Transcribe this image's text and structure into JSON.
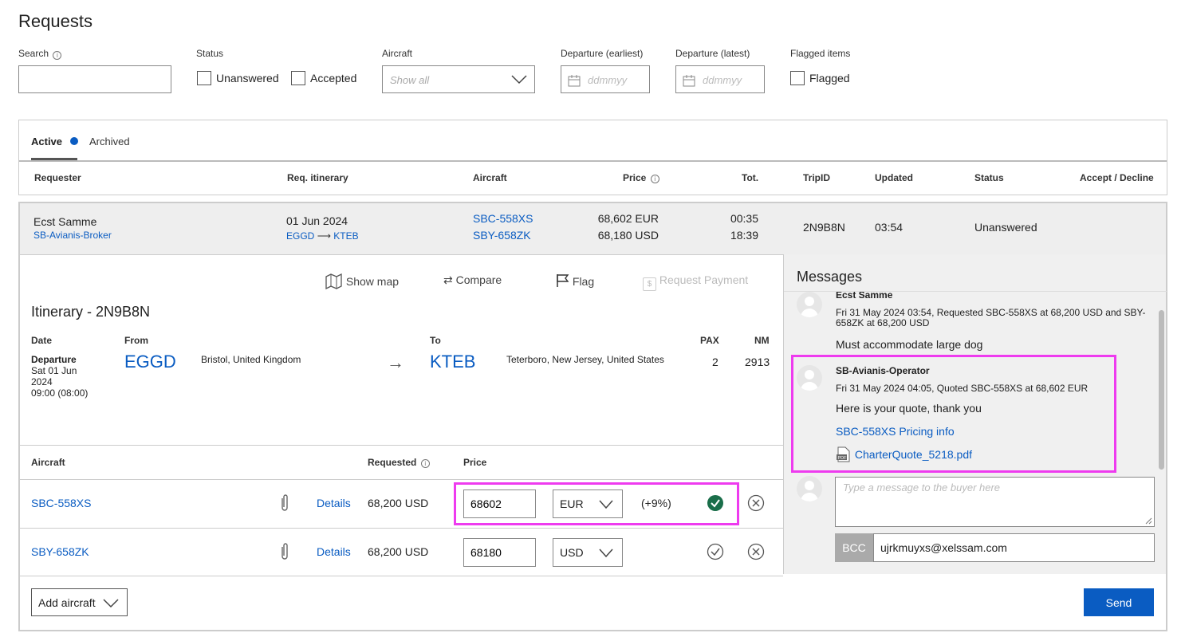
{
  "page": {
    "title": "Requests"
  },
  "filters": {
    "search_label": "Search",
    "status_label": "Status",
    "unanswered_label": "Unanswered",
    "accepted_label": "Accepted",
    "aircraft_label": "Aircraft",
    "aircraft_placeholder": "Show all",
    "dep_earliest_label": "Departure (earliest)",
    "dep_latest_label": "Departure (latest)",
    "date_placeholder": "ddmmyy",
    "flagged_items_label": "Flagged items",
    "flagged_label": "Flagged"
  },
  "tabs": {
    "active": "Active",
    "archived": "Archived"
  },
  "columns": {
    "requester": "Requester",
    "itinerary": "Req. itinerary",
    "aircraft": "Aircraft",
    "price": "Price",
    "tot": "Tot.",
    "tripid": "TripID",
    "updated": "Updated",
    "status": "Status",
    "accept": "Accept / Decline"
  },
  "request": {
    "name": "Ecst Samme",
    "broker": "SB-Avianis-Broker",
    "date": "01 Jun 2024",
    "from": "EGGD",
    "to": "KTEB",
    "aircraft1": "SBC-558XS",
    "aircraft2": "SBY-658ZK",
    "price1": "68,602 EUR",
    "price2": "68,180 USD",
    "tot1": "00:35",
    "tot2": "18:39",
    "tripid": "2N9B8N",
    "updated": "03:54",
    "status": "Unanswered"
  },
  "actions": {
    "show_map": "Show map",
    "compare": "Compare",
    "flag": "Flag",
    "request_payment": "Request Payment"
  },
  "itinerary": {
    "title": "Itinerary - 2N9B8N",
    "date_h": "Date",
    "from_h": "From",
    "to_h": "To",
    "pax_h": "PAX",
    "nm_h": "NM",
    "leg_label": "Departure",
    "leg_date1": "Sat 01 Jun",
    "leg_date2": "2024",
    "leg_time": "09:00 (08:00)",
    "from_code": "EGGD",
    "from_city": "Bristol, United Kingdom",
    "to_code": "KTEB",
    "to_city": "Teterboro, New Jersey, United States",
    "pax": "2",
    "nm": "2913"
  },
  "aircraft_table": {
    "aircraft_h": "Aircraft",
    "requested_h": "Requested",
    "price_h": "Price",
    "details": "Details",
    "rows": [
      {
        "reg": "SBC-558XS",
        "requested": "68,200 USD",
        "price": "68602",
        "currency": "EUR",
        "diff": "(+9%)"
      },
      {
        "reg": "SBY-658ZK",
        "requested": "68,200 USD",
        "price": "68180",
        "currency": "USD",
        "diff": ""
      }
    ],
    "add_aircraft": "Add aircraft"
  },
  "messages": {
    "title": "Messages",
    "m1_sender": "Ecst Samme",
    "m1_meta": "Fri 31 May 2024 03:54, Requested SBC-558XS at 68,200 USD and SBY-658ZK at 68,200 USD",
    "m1_text": "Must accommodate large dog",
    "m2_sender": "SB-Avianis-Operator",
    "m2_meta": "Fri 31 May 2024 04:05, Quoted SBC-558XS at 68,602 EUR",
    "m2_text": "Here is your quote, thank you",
    "m2_link": "SBC-558XS Pricing info",
    "m2_file": "CharterQuote_5218.pdf",
    "compose_placeholder": "Type a message to the buyer here",
    "bcc_label": "BCC",
    "bcc_value": "ujrkmuyxs@xelssam.com",
    "send": "Send"
  },
  "colors": {
    "accent": "#0a5cc2",
    "highlight": "#ee3bef",
    "ok": "#1a6e4a"
  }
}
